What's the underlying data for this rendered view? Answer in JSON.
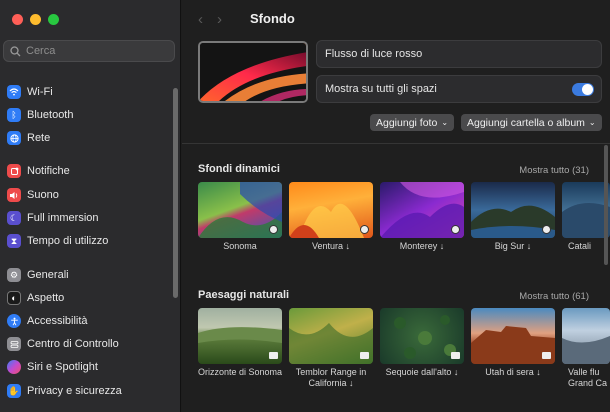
{
  "window": {
    "traffic_lights": [
      "#ff5f57",
      "#febc2e",
      "#28c840"
    ]
  },
  "sidebar": {
    "search_placeholder": "Cerca",
    "items": [
      {
        "label": "Wi-Fi",
        "icon": "wifi-icon",
        "color": "#2f7cf6"
      },
      {
        "label": "Bluetooth",
        "icon": "bluetooth-icon",
        "color": "#2f7cf6"
      },
      {
        "label": "Rete",
        "icon": "network-icon",
        "color": "#2f7cf6"
      },
      {
        "label": "Notifiche",
        "icon": "bell-icon",
        "color": "#ee4b4b"
      },
      {
        "label": "Suono",
        "icon": "speaker-icon",
        "color": "#ee4b4b"
      },
      {
        "label": "Full immersion",
        "icon": "moon-icon",
        "color": "#5a4fcf"
      },
      {
        "label": "Tempo di utilizzo",
        "icon": "hourglass-icon",
        "color": "#5a4fcf"
      },
      {
        "label": "Generali",
        "icon": "gear-icon",
        "color": "#8e8e93"
      },
      {
        "label": "Aspetto",
        "icon": "appearance-icon",
        "color": "#1a1a1a"
      },
      {
        "label": "Accessibilità",
        "icon": "accessibility-icon",
        "color": "#2f7cf6"
      },
      {
        "label": "Centro di Controllo",
        "icon": "control-center-icon",
        "color": "#8e8e93"
      },
      {
        "label": "Siri e Spotlight",
        "icon": "siri-icon",
        "color": "#c24ad0"
      },
      {
        "label": "Privacy e sicurezza",
        "icon": "hand-icon",
        "color": "#2f7cf6"
      }
    ]
  },
  "header": {
    "back": "‹",
    "forward": "›",
    "title": "Sfondo"
  },
  "current": {
    "name": "Flusso di luce rosso",
    "show_all_spaces_label": "Mostra su tutti gli spazi",
    "show_all_spaces_on": true,
    "add_photo": "Aggiungi foto",
    "add_folder": "Aggiungi cartella o album"
  },
  "sections": {
    "dynamic": {
      "title": "Sfondi dinamici",
      "show_all": "Mostra tutto (31)",
      "items": [
        {
          "caption": "Sonoma"
        },
        {
          "caption": "Ventura ↓"
        },
        {
          "caption": "Monterey ↓"
        },
        {
          "caption": "Big Sur ↓"
        },
        {
          "caption": "Catali"
        }
      ]
    },
    "landscapes": {
      "title": "Paesaggi naturali",
      "show_all": "Mostra tutto (61)",
      "items": [
        {
          "caption": "Orizzonte di Sonoma"
        },
        {
          "caption": "Temblor Range in California ↓"
        },
        {
          "caption": "Sequoie dall'alto ↓"
        },
        {
          "caption": "Utah di sera ↓"
        },
        {
          "caption": "Valle flu Grand Ca"
        }
      ]
    }
  }
}
